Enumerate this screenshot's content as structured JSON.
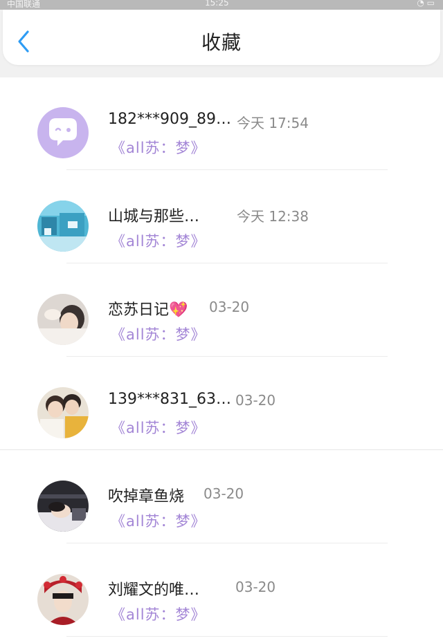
{
  "status_bar": {
    "carrier": "中国联通",
    "time": "15:25",
    "icons": "◔ ▭"
  },
  "header": {
    "title": "收藏",
    "back_icon": "chevron-left-icon",
    "accent": "#2e9cf4"
  },
  "snippet_color": "#a386d6",
  "items": [
    {
      "name": "182***909_89…",
      "time": "今天 17:54",
      "snippet": "《all苏：梦》"
    },
    {
      "name": "山城与那些…",
      "time": "今天 12:38",
      "snippet": "《all苏：梦》"
    },
    {
      "name": "恋苏日记💖",
      "time": "03-20",
      "snippet": "《all苏：梦》"
    },
    {
      "name": "139***831_63…",
      "time": "03-20",
      "snippet": "《all苏：梦》"
    },
    {
      "name": "吹掉章鱼烧",
      "time": "03-20",
      "snippet": "《all苏：梦》"
    },
    {
      "name": "刘耀文的唯…",
      "time": "03-20",
      "snippet": "《all苏：梦》"
    }
  ]
}
